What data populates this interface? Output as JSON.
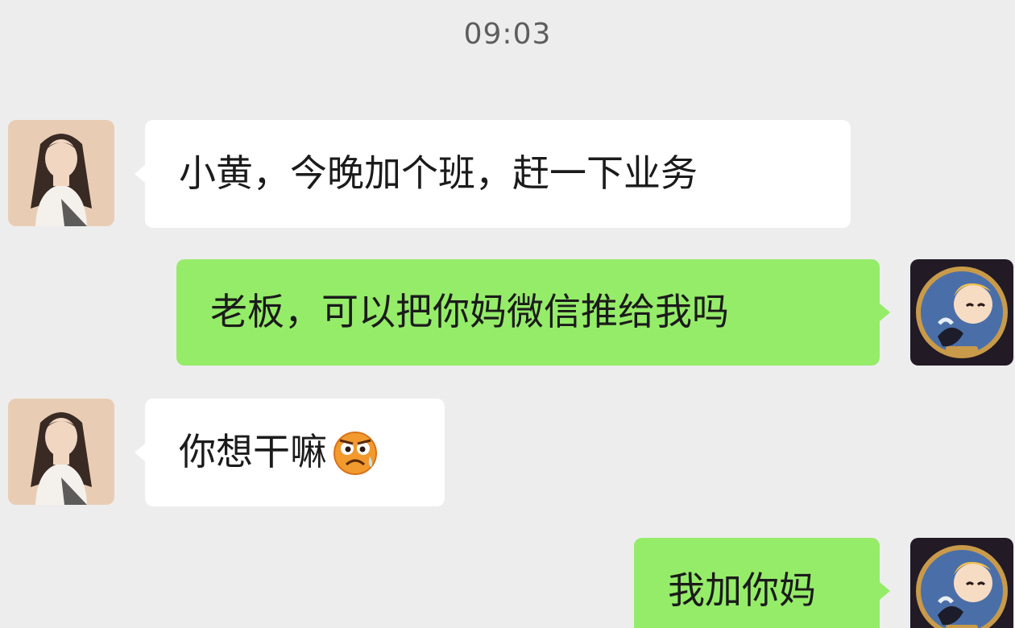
{
  "chat": {
    "timestamp": "09:03",
    "messages": [
      {
        "sender": "boss",
        "direction": "incoming",
        "text": "小黄，今晚加个班，赶一下业务",
        "avatar_icon": "woman-portrait-avatar"
      },
      {
        "sender": "me",
        "direction": "outgoing",
        "text": "老板，可以把你妈微信推给我吗",
        "avatar_icon": "anime-character-avatar"
      },
      {
        "sender": "boss",
        "direction": "incoming",
        "text": "你想干嘛",
        "emoji": "angry-sweat-emoji",
        "avatar_icon": "woman-portrait-avatar"
      },
      {
        "sender": "me",
        "direction": "outgoing",
        "text": "我加你妈",
        "avatar_icon": "anime-character-avatar"
      }
    ]
  },
  "colors": {
    "background": "#ededed",
    "incoming_bubble": "#ffffff",
    "outgoing_bubble": "#95ec69",
    "timestamp_text": "#5d5d5d"
  }
}
